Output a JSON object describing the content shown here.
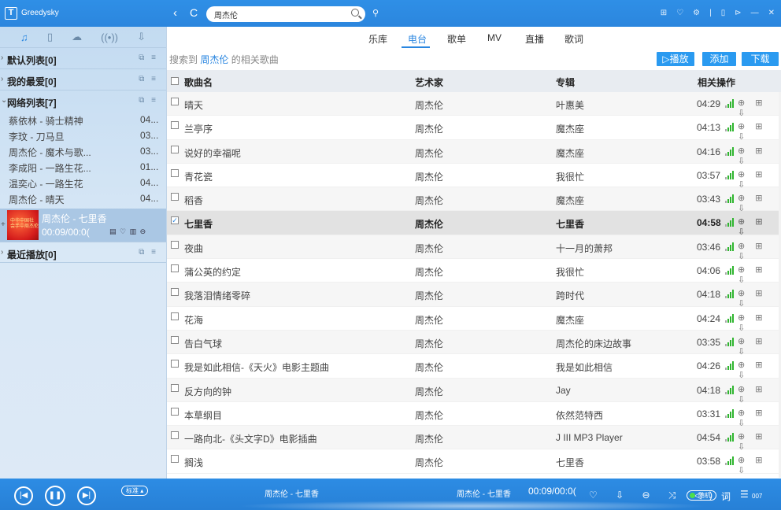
{
  "app": {
    "logo": "T",
    "title": "Greedysky"
  },
  "nav": {
    "back": "‹",
    "refresh": "C"
  },
  "search": {
    "value": "周杰伦"
  },
  "window_icons": [
    "⊞",
    "♡",
    "⚙",
    "|",
    "▯",
    "⊳",
    "—",
    "✕"
  ],
  "sidebar": {
    "tabs": [
      "♫",
      "▯",
      "☁",
      "((•))",
      "⇩"
    ],
    "sections": {
      "default": {
        "label": "默认列表[0]"
      },
      "favorites": {
        "label": "我的最爱[0]"
      },
      "network": {
        "label": "网络列表[7]"
      },
      "recent": {
        "label": "最近播放[0]"
      }
    },
    "ops": "⧉ ≡",
    "network_items": [
      {
        "name": "蔡依林 - 骑士精神",
        "dur": "04..."
      },
      {
        "name": "李玟 - 刀马旦",
        "dur": "03..."
      },
      {
        "name": "周杰伦 - 魔术与歌...",
        "dur": "03..."
      },
      {
        "name": "李成阳 - 一路生花...",
        "dur": "01..."
      },
      {
        "name": "温奕心 - 一路生花",
        "dur": "04..."
      },
      {
        "name": "周杰伦 - 晴天",
        "dur": "04..."
      }
    ],
    "now_playing": {
      "title": "周杰伦 - 七里香",
      "time": "00:09/00:0(",
      "ops": "▤ ♡ ▥ ⊖",
      "cover_text": "中华中国社 会手中周杰伦"
    }
  },
  "main": {
    "tabs": [
      "乐库",
      "电台",
      "歌单",
      "MV",
      "直播",
      "歌词"
    ],
    "active_tab": "电台",
    "info_prefix": "搜索到",
    "info_keyword": "周杰伦",
    "info_suffix": "的相关歌曲",
    "buttons": {
      "play": "▷播放",
      "add": "添加",
      "download": "下载"
    },
    "headers": {
      "name": "歌曲名",
      "artist": "艺术家",
      "album": "专辑",
      "ops": "相关操作"
    },
    "row_icons": "⊕ ⊞ ⇩",
    "rows": [
      {
        "name": "晴天",
        "artist": "周杰伦",
        "album": "叶惠美",
        "dur": "04:29"
      },
      {
        "name": "兰亭序",
        "artist": "周杰伦",
        "album": "魔杰座",
        "dur": "04:13"
      },
      {
        "name": "说好的幸福呢",
        "artist": "周杰伦",
        "album": "魔杰座",
        "dur": "04:16"
      },
      {
        "name": "青花瓷",
        "artist": "周杰伦",
        "album": "我很忙",
        "dur": "03:57"
      },
      {
        "name": "稻香",
        "artist": "周杰伦",
        "album": "魔杰座",
        "dur": "03:43"
      },
      {
        "name": "七里香",
        "artist": "周杰伦",
        "album": "七里香",
        "dur": "04:58",
        "checked": true
      },
      {
        "name": "夜曲",
        "artist": "周杰伦",
        "album": "十一月的萧邦",
        "dur": "03:46"
      },
      {
        "name": "蒲公英的约定",
        "artist": "周杰伦",
        "album": "我很忙",
        "dur": "04:06"
      },
      {
        "name": "我落泪情绪零碎",
        "artist": "周杰伦",
        "album": "跨时代",
        "dur": "04:18"
      },
      {
        "name": "花海",
        "artist": "周杰伦",
        "album": "魔杰座",
        "dur": "04:24"
      },
      {
        "name": "告白气球",
        "artist": "周杰伦",
        "album": "周杰伦的床边故事",
        "dur": "03:35"
      },
      {
        "name": "我是如此相信-《天火》电影主题曲",
        "artist": "周杰伦",
        "album": "我是如此相信",
        "dur": "04:26"
      },
      {
        "name": "反方向的钟",
        "artist": "周杰伦",
        "album": "Jay",
        "dur": "04:18"
      },
      {
        "name": "本草纲目",
        "artist": "周杰伦",
        "album": "依然范特西",
        "dur": "03:31"
      },
      {
        "name": "一路向北-《头文字D》电影插曲",
        "artist": "周杰伦",
        "album": "J III MP3 Player",
        "dur": "04:54"
      },
      {
        "name": "搁浅",
        "artist": "周杰伦",
        "album": "七里香",
        "dur": "03:58"
      }
    ]
  },
  "player": {
    "prev": "|◀",
    "pause": "❚❚",
    "next": "▶|",
    "quality": "标准 ▴",
    "title_left": "周杰伦 - 七里香",
    "title_right": "周杰伦 - 七里香",
    "time": "00:09/00:0(",
    "icons": "♡ ⇩ ⊖ ⤨ ◁)",
    "mode": "随机",
    "lyric": "词",
    "playlist": "☰",
    "count": "007"
  }
}
